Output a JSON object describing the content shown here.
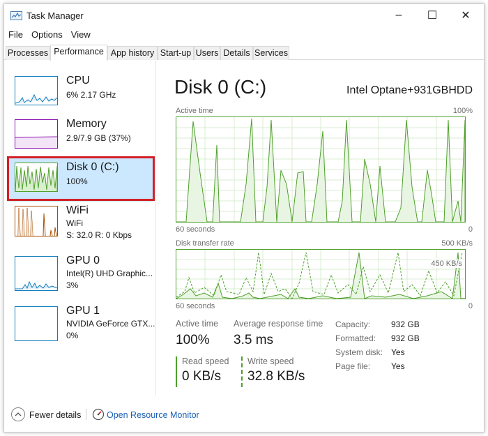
{
  "window": {
    "title": "Task Manager",
    "minimize": "–",
    "maximize": "☐",
    "close": "✕"
  },
  "menu": [
    "File",
    "Options",
    "View"
  ],
  "tabs": [
    "Processes",
    "Performance",
    "App history",
    "Start-up",
    "Users",
    "Details",
    "Services"
  ],
  "active_tab": "Performance",
  "sidebar": {
    "items": [
      {
        "name": "CPU",
        "line1": "6%  2.17 GHz",
        "line2": ""
      },
      {
        "name": "Memory",
        "line1": "2.9/7.9 GB (37%)",
        "line2": ""
      },
      {
        "name": "Disk 0 (C:)",
        "line1": "100%",
        "line2": ""
      },
      {
        "name": "WiFi",
        "line1": "WiFi",
        "line2": "S: 32.0  R: 0 Kbps"
      },
      {
        "name": "GPU 0",
        "line1": "Intel(R) UHD Graphic...",
        "line2": "3%"
      },
      {
        "name": "GPU 1",
        "line1": "NVIDIA GeForce GTX...",
        "line2": "0%"
      }
    ],
    "selected": "Disk 0 (C:)"
  },
  "main": {
    "title": "Disk 0 (C:)",
    "model": "Intel Optane+931GBHDD",
    "active_time_graph": {
      "label": "Active time",
      "max": "100%",
      "x_left": "60 seconds",
      "x_right": "0"
    },
    "transfer_graph": {
      "label": "Disk transfer rate",
      "max": "500 KB/s",
      "mark": "450 KB/s",
      "x_left": "60 seconds",
      "x_right": "0"
    },
    "stats": {
      "active_time_label": "Active time",
      "active_time_value": "100%",
      "avg_response_label": "Average response time",
      "avg_response_value": "3.5 ms",
      "read_label": "Read speed",
      "read_value": "0 KB/s",
      "write_label": "Write speed",
      "write_value": "32.8 KB/s"
    },
    "details": [
      {
        "key": "Capacity:",
        "value": "932 GB"
      },
      {
        "key": "Formatted:",
        "value": "932 GB"
      },
      {
        "key": "System disk:",
        "value": "Yes"
      },
      {
        "key": "Page file:",
        "value": "Yes"
      }
    ]
  },
  "footer": {
    "fewer_details": "Fewer details",
    "resource_monitor": "Open Resource Monitor"
  },
  "colors": {
    "disk": "#4fa02c",
    "cpu": "#117dbb",
    "memory": "#8b12ae",
    "wifi": "#a74f01",
    "selection": "#cce8ff",
    "highlight": "#d32025"
  }
}
